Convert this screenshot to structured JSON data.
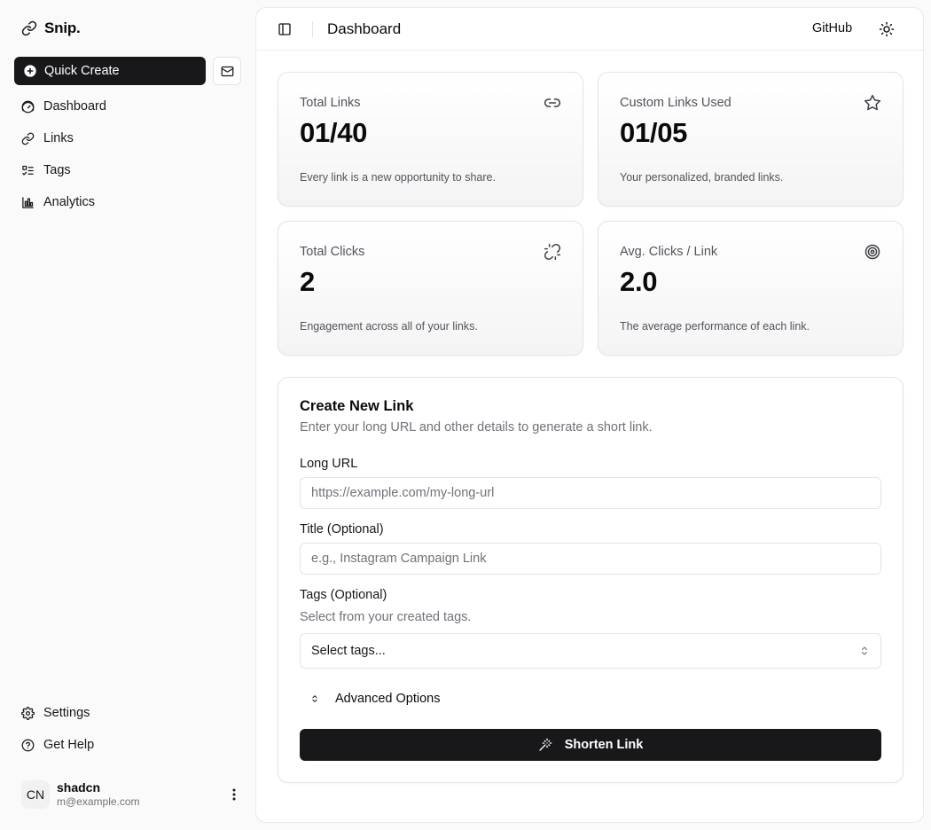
{
  "brand": {
    "name": "Snip."
  },
  "sidebar": {
    "quick_create": "Quick Create",
    "items": [
      {
        "label": "Dashboard",
        "icon": "gauge-icon"
      },
      {
        "label": "Links",
        "icon": "link-icon"
      },
      {
        "label": "Tags",
        "icon": "list-icon"
      },
      {
        "label": "Analytics",
        "icon": "bar-chart-icon"
      }
    ],
    "bottom_items": [
      {
        "label": "Settings",
        "icon": "gear-icon"
      },
      {
        "label": "Get Help",
        "icon": "help-circle-icon"
      }
    ],
    "user": {
      "initials": "CN",
      "name": "shadcn",
      "email": "m@example.com"
    }
  },
  "header": {
    "title": "Dashboard",
    "github": "GitHub"
  },
  "stats": [
    {
      "label": "Total Links",
      "value": "01/40",
      "footer": "Every link is a new opportunity to share.",
      "icon": "link-icon"
    },
    {
      "label": "Custom Links Used",
      "value": "01/05",
      "footer": "Your personalized, branded links.",
      "icon": "star-icon"
    },
    {
      "label": "Total Clicks",
      "value": "2",
      "footer": "Engagement across all of your links.",
      "icon": "broken-link-icon"
    },
    {
      "label": "Avg. Clicks / Link",
      "value": "2.0",
      "footer": "The average performance of each link.",
      "icon": "target-icon"
    }
  ],
  "form": {
    "title": "Create New Link",
    "description": "Enter your long URL and other details to generate a short link.",
    "long_url_label": "Long URL",
    "long_url_placeholder": "https://example.com/my-long-url",
    "title_label": "Title (Optional)",
    "title_placeholder": "e.g., Instagram Campaign Link",
    "tags_label": "Tags (Optional)",
    "tags_hint": "Select from your created tags.",
    "tags_select": "Select tags...",
    "advanced": "Advanced Options",
    "submit": "Shorten Link"
  },
  "colors": {
    "primary": "#18181b",
    "muted_text": "#71717a",
    "border": "#e4e4e7"
  }
}
